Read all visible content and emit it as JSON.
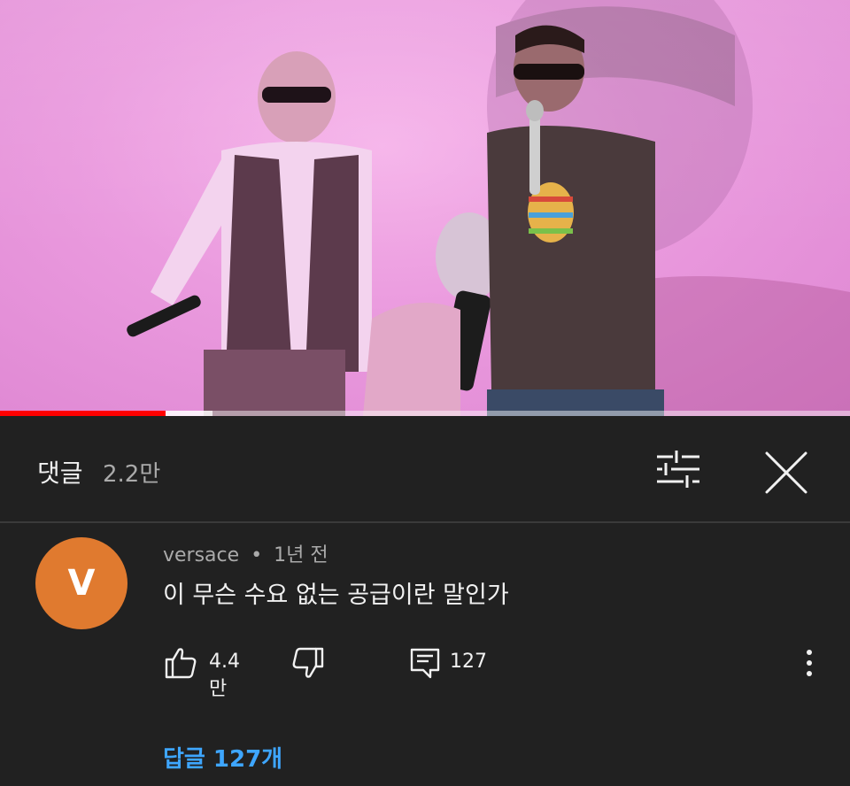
{
  "player": {
    "progress_percent": 19.5,
    "buffered_percent": 25
  },
  "comments_panel": {
    "title": "댓글",
    "count": "2.2만",
    "filter_icon": "sliders-icon",
    "close_icon": "close-icon"
  },
  "comment": {
    "avatar_letter": "V",
    "avatar_color": "#e07a2f",
    "author": "versace",
    "separator": "•",
    "time": "1년 전",
    "text": "이 무슨 수요 없는 공급이란 말인가",
    "like_count": "4.4만",
    "reply_count": "127",
    "replies_link": "답글 127개"
  },
  "colors": {
    "background": "#212121",
    "link": "#3ea6ff",
    "progress": "#ff0000"
  }
}
